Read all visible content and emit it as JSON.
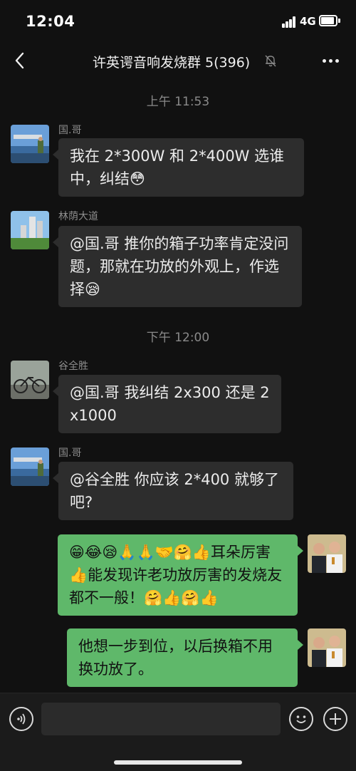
{
  "status_bar": {
    "time": "12:04",
    "network": "4G"
  },
  "header": {
    "title": "许英谔音响发烧群 5(396)",
    "back_icon": "chevron-left-icon",
    "mute_icon": "bell-slash-icon",
    "more_icon": "ellipsis-icon"
  },
  "timestamps": [
    "上午 11:53",
    "下午 12:00"
  ],
  "messages": [
    {
      "sender": "国.哥",
      "text": "我在 2*300W 和 2*400W 选谁中，纠结😳"
    },
    {
      "sender": "林荫大道",
      "text": "@国.哥  推你的箱子功率肯定没问题，那就在功放的外观上，作选择😪"
    },
    {
      "sender": "谷全胜",
      "text": "@国.哥 我纠结 2x300 还是 2x1000"
    },
    {
      "sender": "国.哥",
      "text": "@谷全胜 你应该 2*400 就够了吧?"
    },
    {
      "sender": "",
      "text": "😁😂😪🙏🙏🤝🤗👍耳朵厉害👍能发现许老功放厉害的发烧友都不一般！🤗👍🤗👍"
    },
    {
      "sender": "",
      "text": "他想一步到位，以后换箱不用换功放了。"
    }
  ],
  "input_bar": {
    "voice_icon": "voice-icon",
    "emoji_icon": "emoji-icon",
    "plus_icon": "plus-icon"
  },
  "colors": {
    "background": "#111111",
    "incoming_bubble": "#2d2d2d",
    "outgoing_bubble": "#5fb86a"
  }
}
